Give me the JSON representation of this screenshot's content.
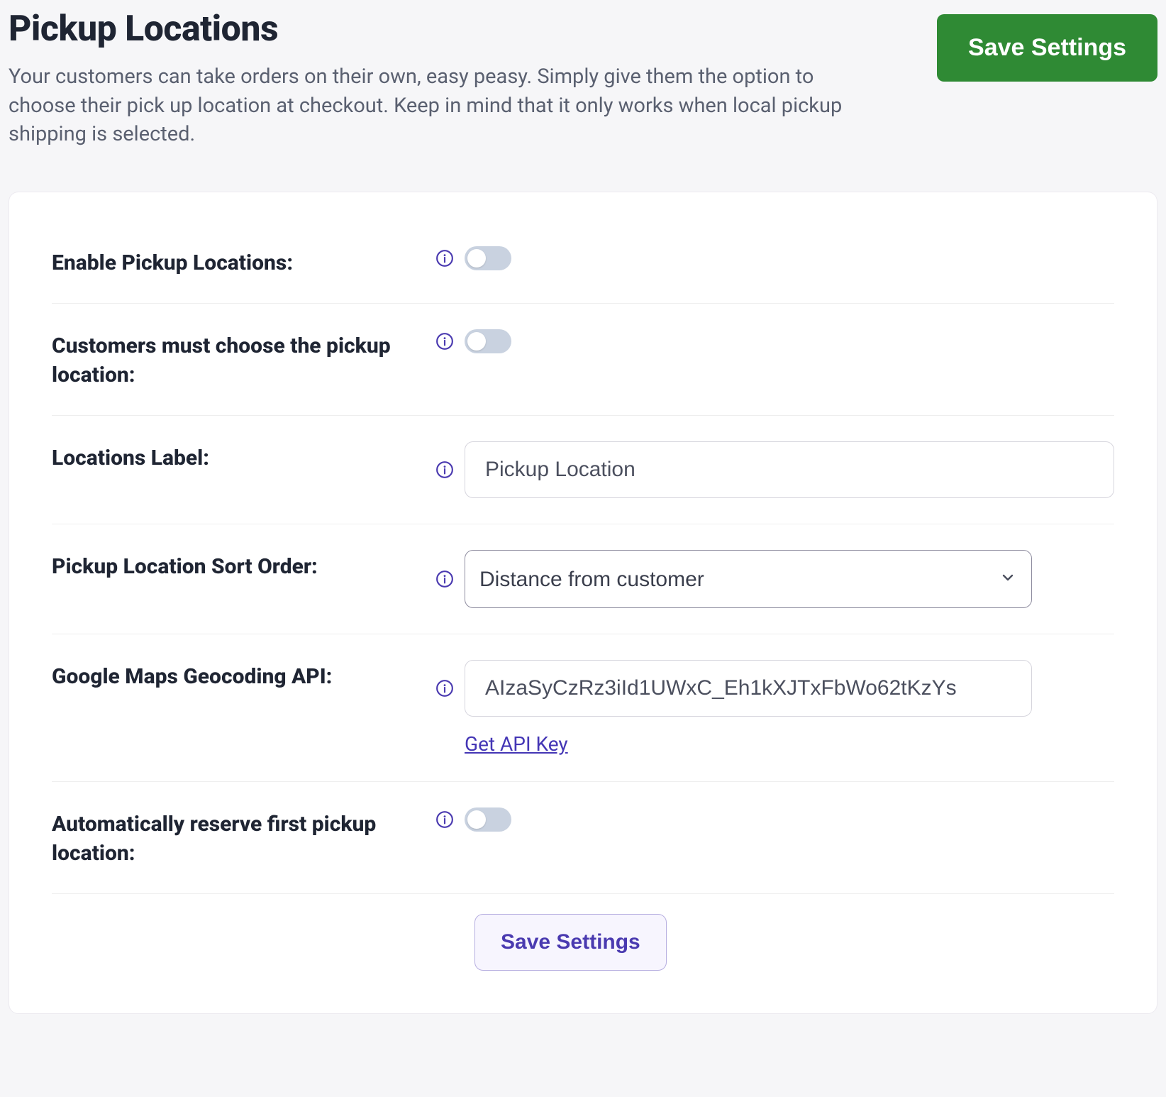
{
  "header": {
    "title": "Pickup Locations",
    "description": "Your customers can take orders on their own, easy peasy. Simply give them the option to choose their pick up location at checkout. Keep in mind that it only works when local pickup shipping is selected.",
    "save_button": "Save Settings"
  },
  "form": {
    "enable": {
      "label": "Enable Pickup Locations:",
      "value": false
    },
    "must_choose": {
      "label": "Customers must choose the pickup location:",
      "value": false
    },
    "locations_label": {
      "label": "Locations Label:",
      "value": "Pickup Location"
    },
    "sort_order": {
      "label": "Pickup Location Sort Order:",
      "value": "Distance from customer"
    },
    "geocoding": {
      "label": "Google Maps Geocoding API:",
      "value": "AIzaSyCzRz3iId1UWxC_Eh1kXJTxFbWo62tKzYs",
      "helper_link": "Get API Key"
    },
    "auto_reserve": {
      "label": "Automatically reserve first pickup location:",
      "value": false
    },
    "submit": "Save Settings"
  }
}
